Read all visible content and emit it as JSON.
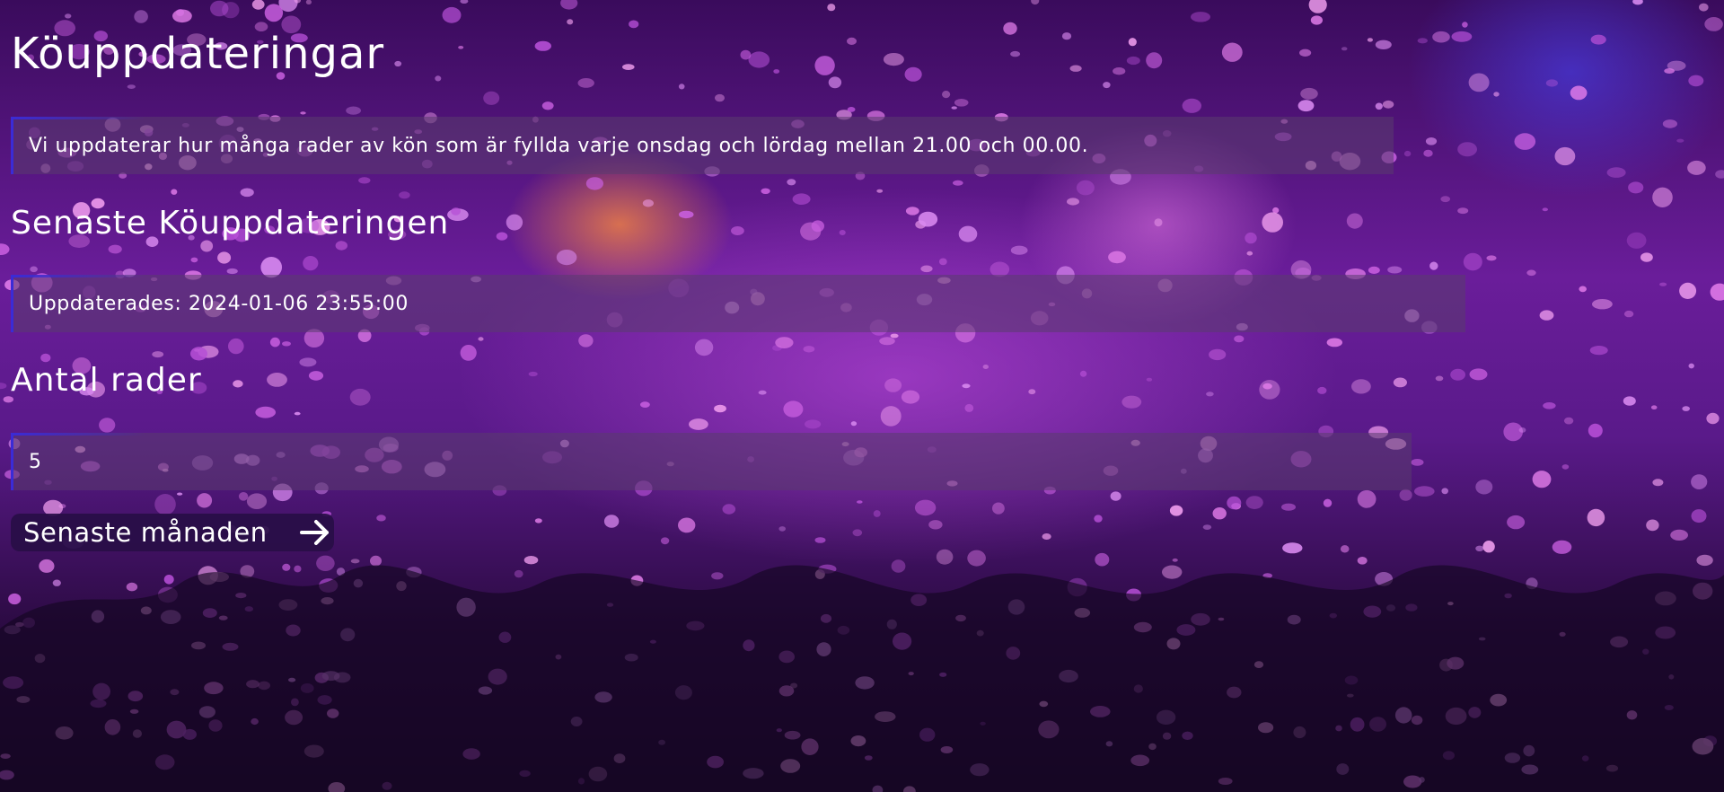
{
  "page": {
    "title": "Köuppdateringar",
    "info_text": "Vi uppdaterar hur många rader av kön som är fyllda varje onsdag och lördag mellan 21.00 och 00.00."
  },
  "latest": {
    "heading": "Senaste Köuppdateringen",
    "updated_text": "Uppdaterades: 2024-01-06 23:55:00"
  },
  "rows": {
    "heading": "Antal rader",
    "value": "5"
  },
  "button": {
    "label": "Senaste månaden",
    "icon": "arrow-right-icon"
  },
  "colors": {
    "accent": "#3b2bd6",
    "button_bg": "#280e46",
    "text": "#ffffff"
  }
}
